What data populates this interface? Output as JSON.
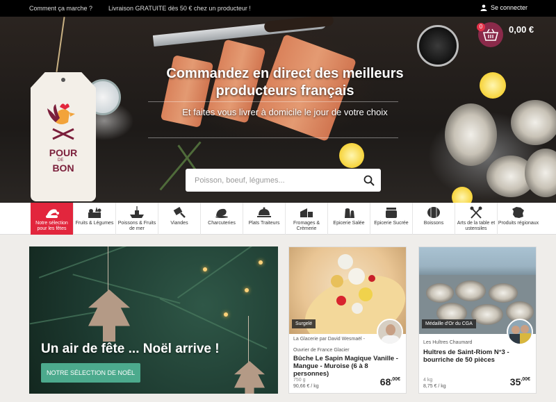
{
  "topbar": {
    "how_it_works": "Comment ça marche ?",
    "delivery_promo": "Livraison GRATUITE dès 50 € chez un producteur !",
    "login": "Se connecter"
  },
  "logo": {
    "line1": "POUR",
    "de": "DE",
    "line2": "BON"
  },
  "cart": {
    "count": "0",
    "total": "0,00 €"
  },
  "hero": {
    "title": "Commandez en direct des meilleurs producteurs français",
    "subtitle": "Et faites vous livrer à domicile le jour de votre choix",
    "search_placeholder": "Poisson, boeuf, légumes..."
  },
  "categories": [
    {
      "label": "Notre sélection pour les fêtes",
      "icon": "santa-hat-icon",
      "active": true
    },
    {
      "label": "Fruits & Légumes",
      "icon": "vegetable-crate-icon"
    },
    {
      "label": "Poissons & Fruits de mer",
      "icon": "fishing-boat-icon"
    },
    {
      "label": "Viandes",
      "icon": "cleaver-icon"
    },
    {
      "label": "Charcuteries",
      "icon": "ham-icon"
    },
    {
      "label": "Plats Traiteurs",
      "icon": "cloche-icon"
    },
    {
      "label": "Fromages & Crèmerie",
      "icon": "cheese-icon"
    },
    {
      "label": "Epicerie Salée",
      "icon": "salt-pepper-icon"
    },
    {
      "label": "Epicerie Sucrée",
      "icon": "jam-jar-icon"
    },
    {
      "label": "Boissons",
      "icon": "barrel-icon"
    },
    {
      "label": "Arts de la table et ustensiles",
      "icon": "utensils-icon"
    },
    {
      "label": "Produits régionaux",
      "icon": "france-map-icon"
    }
  ],
  "banner": {
    "title": "Un air de fête ... Noël arrive !",
    "button": "NOTRE SÉLECTION DE NOËL"
  },
  "products": [
    {
      "badge": "Surgelé",
      "seller": "La Glacerie par David Wesmaël -",
      "seller_sub": "Ouvrier de France Glacier",
      "title": "Bûche Le Sapin Magique Vanille - Mangue - Muroise (6 à 8 personnes)",
      "weight": "750 g",
      "unit_price": "90,66 € / kg",
      "price": "68",
      "price_cents": ",00€"
    },
    {
      "badge": "Médaille d'Or du CGA",
      "seller": "Les Huîtres Chaumard",
      "seller_sub": "",
      "title": "Huîtres de Saint-Riom N°3 - bourriche de 50 pièces",
      "weight": "4 kg",
      "unit_price": "8,75 € / kg",
      "price": "35",
      "price_cents": ",00€"
    }
  ],
  "colors": {
    "accent_red": "#e2263d",
    "button_green": "#4caa8d",
    "brand_burgundy": "#7b1f3b"
  }
}
